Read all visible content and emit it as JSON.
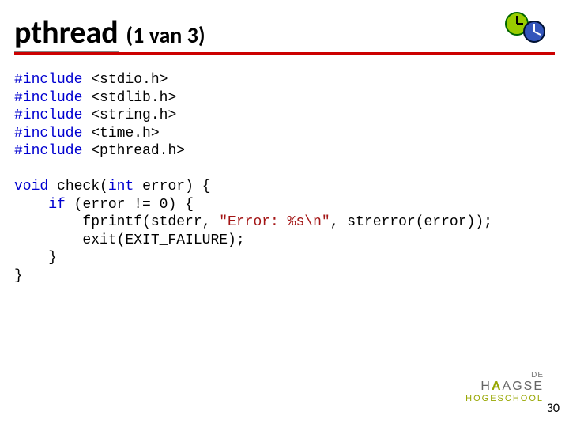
{
  "title": {
    "main": "pthread",
    "sub": "(1 van 3)"
  },
  "code": {
    "includes": [
      {
        "directive": "#include",
        "header": "<stdio.h>"
      },
      {
        "directive": "#include",
        "header": "<stdlib.h>"
      },
      {
        "directive": "#include",
        "header": "<string.h>"
      },
      {
        "directive": "#include",
        "header": "<time.h>"
      },
      {
        "directive": "#include",
        "header": "<pthread.h>"
      }
    ],
    "fn": {
      "ret": "void",
      "name": "check",
      "param_type": "int",
      "param_name": "error",
      "if_kw": "if",
      "cond": "(error != 0) {",
      "fprintf": "        fprintf(stderr, ",
      "fmt": "\"Error: %s\\n\"",
      "fprintf_tail": ", strerror(error));",
      "exit": "        exit(EXIT_FAILURE);",
      "brace_inner": "    }",
      "brace_outer": "}"
    }
  },
  "logo": {
    "line1": "DE",
    "brand_left": "H",
    "brand_a": "A",
    "brand_right": "AGSE",
    "line3": "HOGESCHOOL"
  },
  "slide_number": "30"
}
